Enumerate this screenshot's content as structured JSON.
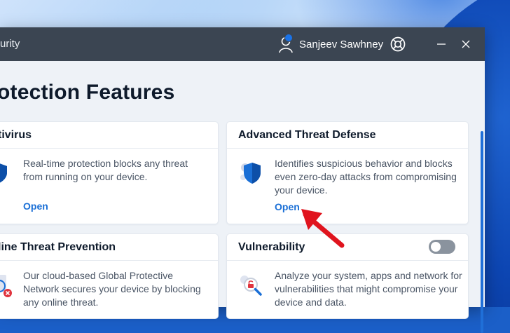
{
  "window": {
    "app_title": "urity",
    "user_name": "Sanjeev Sawhney"
  },
  "page": {
    "title": "otection Features"
  },
  "cards": [
    {
      "title": "tivirus",
      "description": "Real-time protection blocks any threat from running on your device.",
      "link": "Open"
    },
    {
      "title": "Advanced Threat Defense",
      "description": "Identifies suspicious behavior and blocks even zero-day attacks from compromising your device.",
      "link": "Open"
    },
    {
      "title": "line Threat Prevention",
      "description": "Our cloud-based Global Protective Network secures your device by blocking any online threat."
    },
    {
      "title": "Vulnerability",
      "description": "Analyze your system, apps and network for vulnerabilities that might compromise your device and data.",
      "toggle_on": false
    }
  ],
  "colors": {
    "titlebar": "#3b4552",
    "accent": "#1a6fd6",
    "annotation_arrow": "#e0141e"
  }
}
